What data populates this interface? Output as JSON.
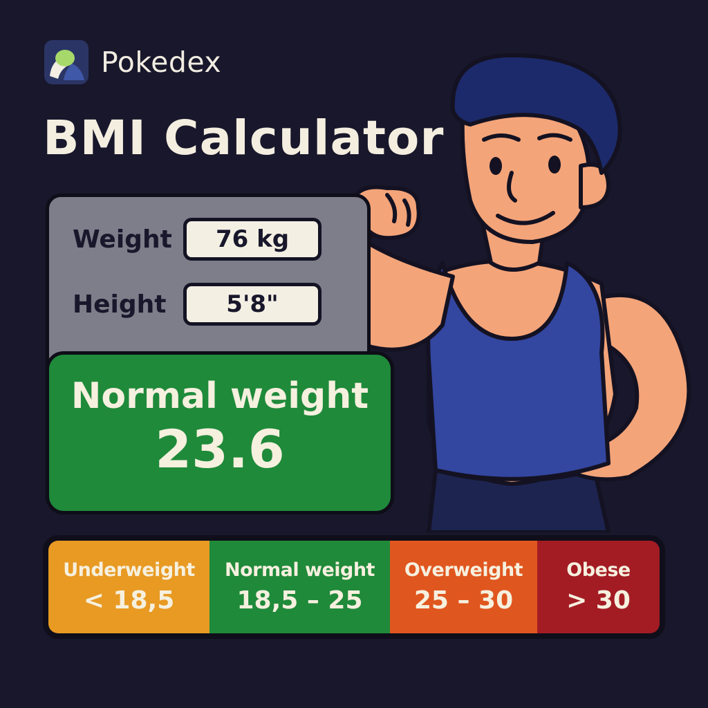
{
  "app": {
    "name": "Pokedex",
    "logo_icon": "app-logo-icon"
  },
  "title": "BMI Calculator",
  "form": {
    "weight_label": "Weight",
    "weight_value": "76 kg",
    "height_label": "Height",
    "height_value": "5'8\""
  },
  "result": {
    "category": "Normal weight",
    "bmi": "23.6",
    "color": "#1f8a3a"
  },
  "scale": [
    {
      "name": "Underweight",
      "range": "< 18,5",
      "color": "#e89a23"
    },
    {
      "name": "Normal weight",
      "range": "18,5 – 25",
      "color": "#1f8a3a"
    },
    {
      "name": "Overweight",
      "range": "25 – 30",
      "color": "#e0561f"
    },
    {
      "name": "Obese",
      "range": "> 30",
      "color": "#a31c24"
    }
  ],
  "illustration": {
    "icon": "flexing-man-illustration"
  }
}
